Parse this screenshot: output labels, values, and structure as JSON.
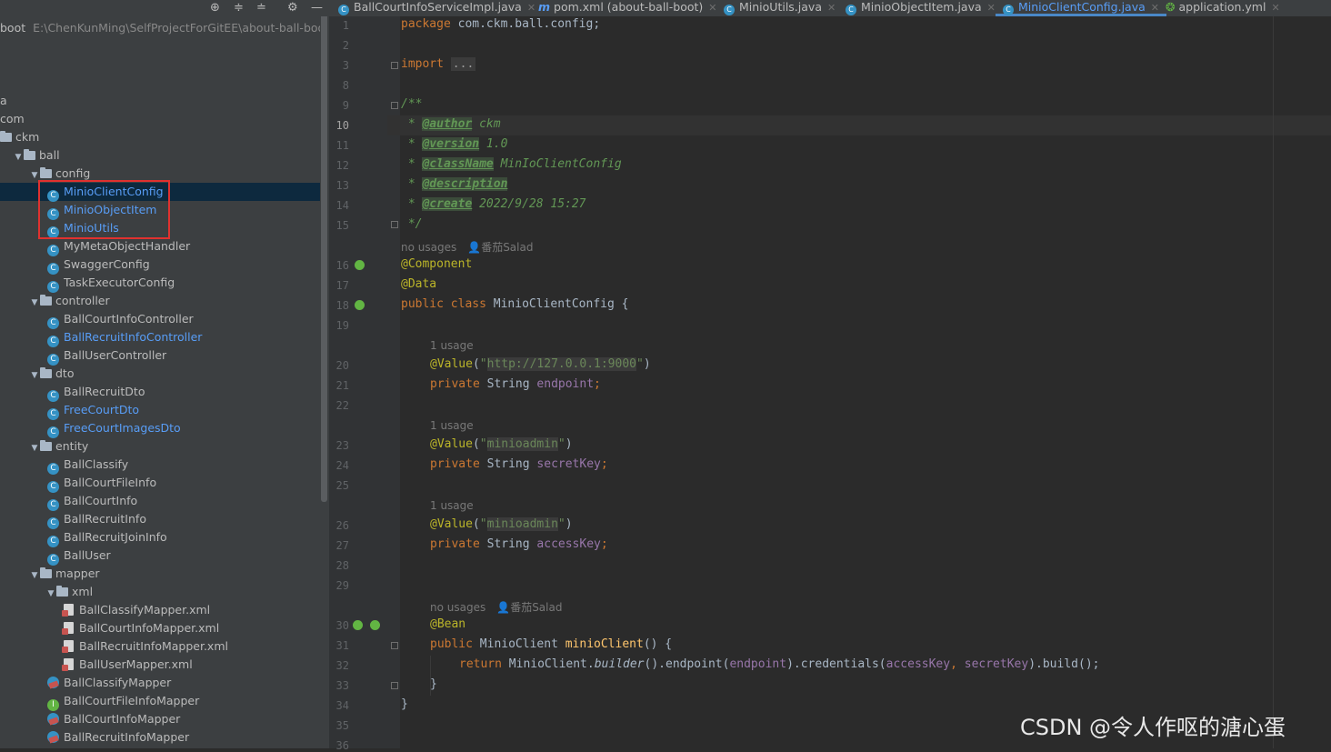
{
  "window": {
    "toolbar_icons": [
      "crosshair-icon",
      "expand-all-icon",
      "collapse-all-icon",
      "gear-icon",
      "minimize-icon"
    ]
  },
  "tabs": [
    {
      "label": "BallCourtInfoServiceImpl.java",
      "icon": "class-icon",
      "active": false
    },
    {
      "label": "pom.xml (about-ball-boot)",
      "icon": "maven-icon",
      "active": false
    },
    {
      "label": "MinioUtils.java",
      "icon": "class-icon",
      "active": false
    },
    {
      "label": "MinioObjectItem.java",
      "icon": "class-icon",
      "active": false
    },
    {
      "label": "MinioClientConfig.java",
      "icon": "class-icon",
      "active": true
    },
    {
      "label": "application.yml",
      "icon": "yaml-icon",
      "active": false
    }
  ],
  "project": {
    "root_label": "boot",
    "root_path": "E:\\ChenKunMing\\SelfProjectForGitEE\\about-ball-boot",
    "items": [
      {
        "label": "a",
        "type": "text"
      },
      {
        "label": "com",
        "type": "text"
      },
      {
        "label": "ckm",
        "type": "folder"
      },
      {
        "label": "ball",
        "type": "folder"
      },
      {
        "label": "config",
        "type": "folder"
      },
      {
        "label": "MinioClientConfig",
        "type": "class",
        "selected": true
      },
      {
        "label": "MinioObjectItem",
        "type": "class"
      },
      {
        "label": "MinioUtils",
        "type": "class"
      },
      {
        "label": "MyMetaObjectHandler",
        "type": "class"
      },
      {
        "label": "SwaggerConfig",
        "type": "class"
      },
      {
        "label": "TaskExecutorConfig",
        "type": "class"
      },
      {
        "label": "controller",
        "type": "folder"
      },
      {
        "label": "BallCourtInfoController",
        "type": "class"
      },
      {
        "label": "BallRecruitInfoController",
        "type": "class"
      },
      {
        "label": "BallUserController",
        "type": "class"
      },
      {
        "label": "dto",
        "type": "folder"
      },
      {
        "label": "BallRecruitDto",
        "type": "class"
      },
      {
        "label": "FreeCourtDto",
        "type": "class"
      },
      {
        "label": "FreeCourtImagesDto",
        "type": "class"
      },
      {
        "label": "entity",
        "type": "folder"
      },
      {
        "label": "BallClassify",
        "type": "class"
      },
      {
        "label": "BallCourtFileInfo",
        "type": "class"
      },
      {
        "label": "BallCourtInfo",
        "type": "class"
      },
      {
        "label": "BallRecruitInfo",
        "type": "class"
      },
      {
        "label": "BallRecruitJoinInfo",
        "type": "class"
      },
      {
        "label": "BallUser",
        "type": "class"
      },
      {
        "label": "mapper",
        "type": "folder"
      },
      {
        "label": "xml",
        "type": "folder"
      },
      {
        "label": "BallClassifyMapper.xml",
        "type": "xml"
      },
      {
        "label": "BallCourtInfoMapper.xml",
        "type": "xml"
      },
      {
        "label": "BallRecruitInfoMapper.xml",
        "type": "xml"
      },
      {
        "label": "BallUserMapper.xml",
        "type": "xml"
      },
      {
        "label": "BallClassifyMapper",
        "type": "mapper"
      },
      {
        "label": "BallCourtFileInfoMapper",
        "type": "interface"
      },
      {
        "label": "BallCourtInfoMapper",
        "type": "mapper"
      },
      {
        "label": "BallRecruitInfoMapper",
        "type": "mapper"
      }
    ]
  },
  "editor": {
    "line_numbers": [
      "1",
      "2",
      "3",
      "8",
      "9",
      "10",
      "11",
      "12",
      "13",
      "14",
      "15",
      "16",
      "17",
      "18",
      "19",
      "20",
      "21",
      "22",
      "23",
      "24",
      "25",
      "26",
      "27",
      "28",
      "29",
      "30",
      "31",
      "32",
      "33",
      "34",
      "35",
      "36"
    ],
    "current_line": "10",
    "pkg_kw": "package",
    "pkg_name": "com.ckm.ball.config;",
    "import_kw": "import",
    "import_fold": "...",
    "doc_open": "/**",
    "doc_star": " * ",
    "author_tag": "@author",
    "author_val": " ckm",
    "version_tag": "@version",
    "version_val": " 1.0",
    "classname_tag": "@className",
    "classname_val": " MinIoClientConfig",
    "description_tag": "@description",
    "create_tag": "@create",
    "create_val": " 2022/9/28 15:27",
    "doc_close": " */",
    "hint_class": "no usages",
    "hint_class_author": "番茄Salad",
    "ann_component": "@Component",
    "ann_data": "@Data",
    "kw_public": "public",
    "kw_class": "class",
    "class_name": "MinioClientConfig",
    "brace_open": " {",
    "hint_usage": "1 usage",
    "ann_value": "@Value",
    "lparen": "(",
    "rparen": ")",
    "q": "\"",
    "endpoint_val": "http://127.0.0.1:9000",
    "secret_val": "minioadmin",
    "access_val": "minioadmin",
    "kw_private": "private",
    "type_string": "String",
    "field_endpoint": "endpoint",
    "field_secret": "secretKey",
    "field_access": "accessKey",
    "semi": ";",
    "hint_bean": "no usages",
    "hint_bean_author": "番茄Salad",
    "ann_bean": "@Bean",
    "type_minio": "MinioClient",
    "method_name": "minioClient",
    "method_sig_end": "() {",
    "kw_return": "return",
    "ret_type": " MinioClient.",
    "builder": "builder",
    "chain1": "().endpoint(",
    "chain2": ").credentials(",
    "comma": ", ",
    "chain3": ").build();",
    "close_brace": "}"
  },
  "watermark": "CSDN @令人作呕的溏心蛋"
}
